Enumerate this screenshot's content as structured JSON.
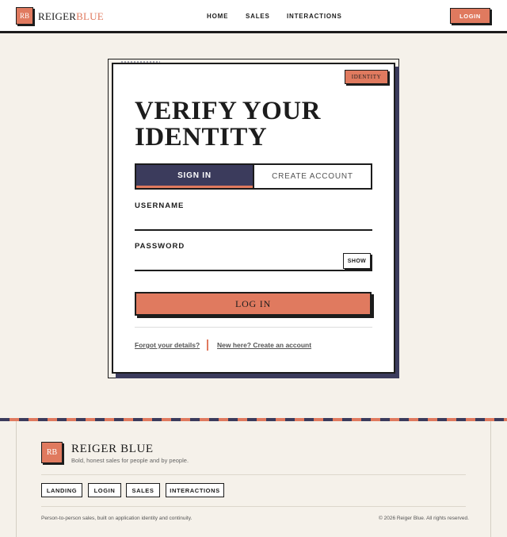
{
  "header": {
    "logo_mark": "RB",
    "brand_first": "REIGER",
    "brand_second": "BLUE",
    "nav": [
      "HOME",
      "SALES",
      "INTERACTIONS"
    ],
    "login_label": "LOGIN"
  },
  "card": {
    "badge": "IDENTITY",
    "title": "VERIFY YOUR IDENTITY",
    "tabs": {
      "signin": "SIGN IN",
      "create": "CREATE ACCOUNT"
    },
    "username_label": "USERNAME",
    "username_value": "",
    "password_label": "PASSWORD",
    "password_value": "",
    "show_label": "SHOW",
    "submit_label": "LOG IN",
    "forgot_link": "Forgot your details?",
    "create_link": "New here? Create an account"
  },
  "footer": {
    "logo_mark": "RB",
    "brand": "REIGER BLUE",
    "tagline": "Bold, honest sales for people and by people.",
    "buttons": [
      "LANDING",
      "LOGIN",
      "SALES",
      "INTERACTIONS"
    ],
    "note": "Person-to-person sales, built on application identity and continuity.",
    "copyright": "© 2026 Reiger Blue. All rights reserved."
  },
  "colors": {
    "accent": "#e07a5f",
    "navy": "#3b3b5c",
    "ink": "#1c1c1c",
    "background": "#f5f1ea"
  }
}
